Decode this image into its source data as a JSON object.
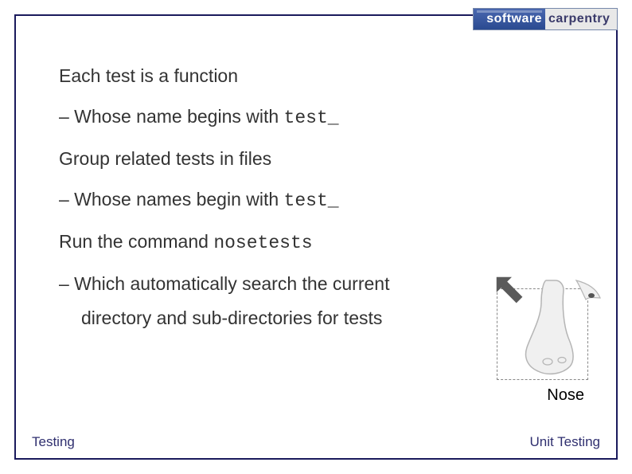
{
  "logo": {
    "left": "software",
    "right": "carpentry"
  },
  "content": {
    "line1": "Each test is a function",
    "line2_pre": "– Whose name begins with ",
    "line2_code": "test_",
    "line3": "Group related tests in files",
    "line4_pre": "– Whose names begin with ",
    "line4_code": "test_",
    "line5_pre": "Run the command ",
    "line5_code": "nosetests",
    "line6": "– Which automatically search the current",
    "line7": "directory and sub-directories for tests"
  },
  "figure": {
    "caption": "Nose"
  },
  "footer": {
    "left": "Testing",
    "right": "Unit Testing"
  }
}
